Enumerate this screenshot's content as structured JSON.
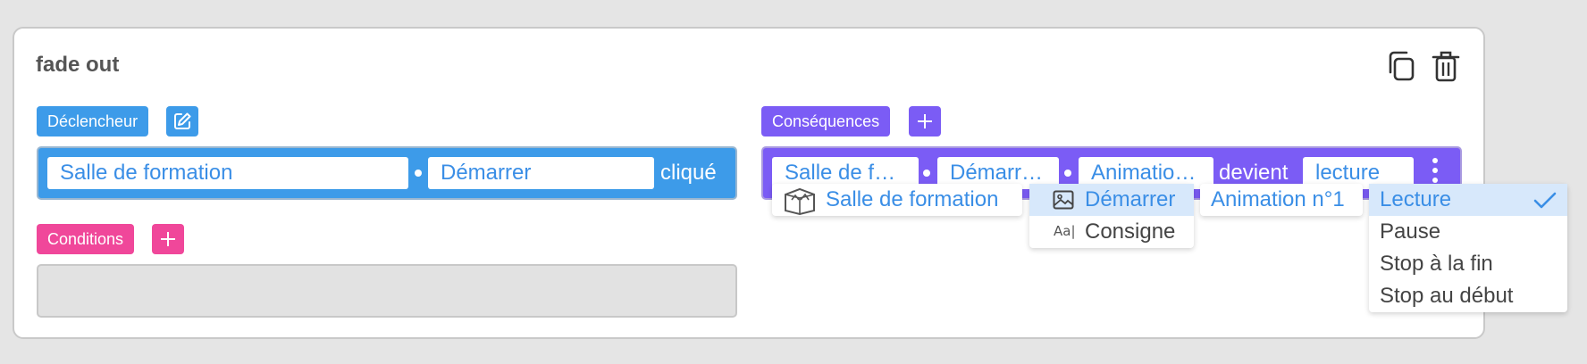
{
  "rule": {
    "title": "fade out"
  },
  "toolbar": {
    "duplicate_icon": "copy-icon",
    "delete_icon": "trash-icon"
  },
  "trigger": {
    "label": "Déclencheur",
    "edit_icon": "edit-icon",
    "room": "Salle de formation",
    "element": "Démarrer",
    "event": "cliqué"
  },
  "conditions": {
    "label": "Conditions",
    "add_icon": "plus-icon"
  },
  "consequences": {
    "label": "Conséquences",
    "add_icon": "plus-icon",
    "room": "Salle de f…",
    "element": "Démarr…",
    "target": "Animatio…",
    "verb": "devient",
    "state": "lecture",
    "more_icon": "vertical-dots-icon"
  },
  "dropdowns": {
    "room": {
      "items": [
        "Salle de formation"
      ]
    },
    "element": {
      "items": [
        "Démarrer",
        "Consigne"
      ]
    },
    "target": {
      "items": [
        "Animation n°1"
      ]
    },
    "state": {
      "items": [
        "Lecture",
        "Pause",
        "Stop à la fin",
        "Stop au début"
      ],
      "selected": "Lecture"
    }
  },
  "colors": {
    "trigger": "#3d9be9",
    "conditions": "#f0479a",
    "consequences": "#7b5cf5",
    "field_text": "#3a8ee6",
    "selected_bg": "#d7e8fb"
  }
}
